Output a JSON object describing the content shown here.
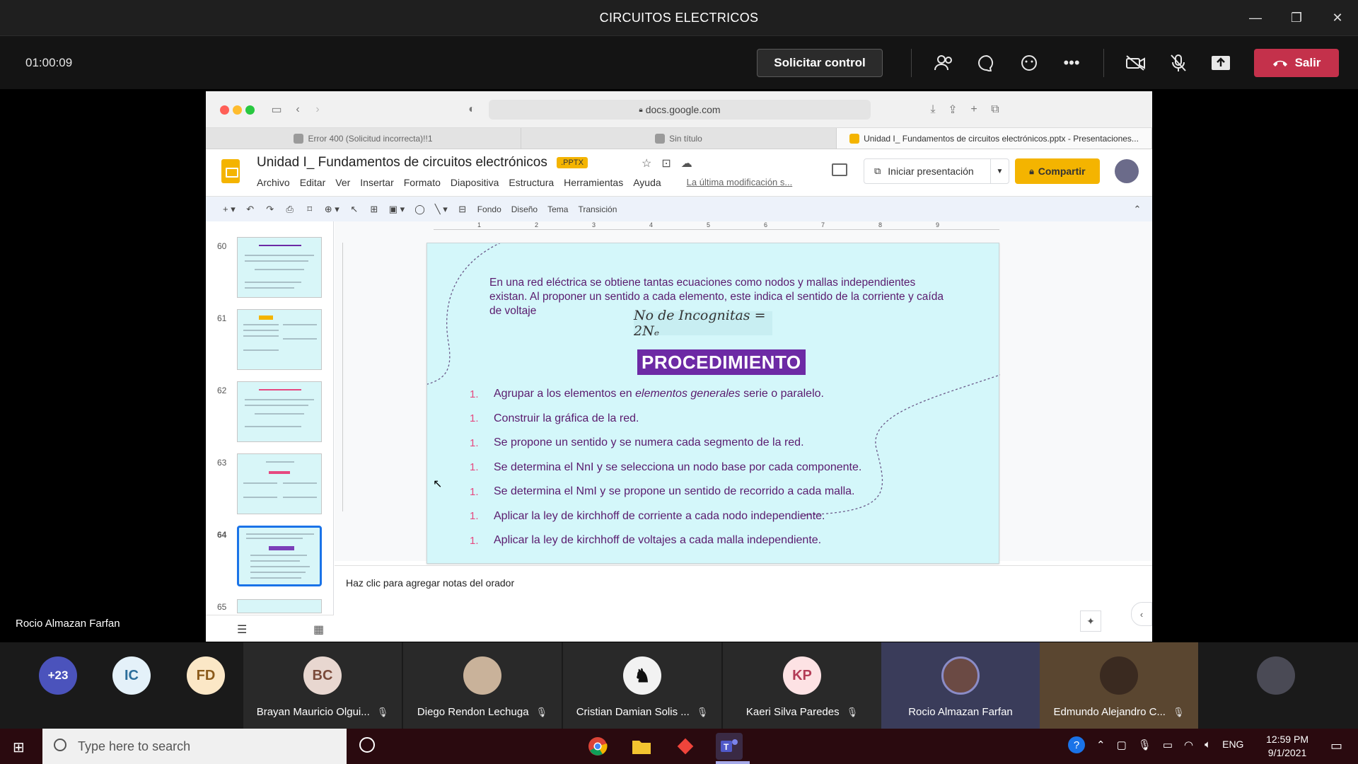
{
  "window": {
    "title": "CIRCUITOS ELECTRICOS",
    "min": "—",
    "max": "❐",
    "close": "✕"
  },
  "meeting": {
    "timer": "01:00:09",
    "request_control": "Solicitar control",
    "leave": "Salir",
    "presenter": "Rocio Almazan Farfan"
  },
  "browser": {
    "url": "docs.google.com",
    "tabs": [
      {
        "label": "Error 400 (Solicitud incorrecta)!!1"
      },
      {
        "label": "Sin título"
      },
      {
        "label": "Unidad I_ Fundamentos de circuitos electrónicos.pptx - Presentaciones..."
      }
    ]
  },
  "docs": {
    "title": "Unidad I_ Fundamentos de circuitos electrónicos",
    "badge": ".PPTX",
    "menu": [
      "Archivo",
      "Editar",
      "Ver",
      "Insertar",
      "Formato",
      "Diapositiva",
      "Estructura",
      "Herramientas",
      "Ayuda"
    ],
    "last_modified": "La última modificación s...",
    "present": "Iniciar presentación",
    "share": "Compartir",
    "toolbar": {
      "background": "Fondo",
      "design": "Diseño",
      "theme": "Tema",
      "transition": "Transición"
    },
    "speaker_notes_placeholder": "Haz clic para agregar notas del orador"
  },
  "thumbnails": [
    {
      "num": "60"
    },
    {
      "num": "61"
    },
    {
      "num": "62"
    },
    {
      "num": "63"
    },
    {
      "num": "64"
    },
    {
      "num": "65"
    }
  ],
  "ruler": [
    "1",
    "2",
    "3",
    "4",
    "5",
    "6",
    "7",
    "8",
    "9"
  ],
  "slide": {
    "intro": "En una red eléctrica se obtiene tantas ecuaciones como nodos y mallas independientes existan. Al proponer un sentido a cada elemento, este indica el sentido de la corriente y caída de voltaje",
    "formula": "No de Incognitas = 2Nₑ",
    "heading": "PROCEDIMIENTO",
    "bullet": "1.",
    "step1_pre": "Agrupar a los elementos en ",
    "step1_em": "elementos generales",
    "step1_post": " serie o paralelo.",
    "steps": [
      "Construir la gráfica de la red.",
      "Se propone un sentido y se numera cada segmento de la red.",
      "Se determina el NnI y se selecciona un nodo base por cada componente.",
      "Se determina el NmI y se propone un sentido de recorrido a cada malla.",
      "Aplicar la ley de kirchhoff de corriente a cada nodo independiente.",
      "Aplicar la ley de kirchhoff de voltajes a cada malla independiente."
    ]
  },
  "participants": [
    {
      "initials": "+23",
      "color": "#4b53bc"
    },
    {
      "initials": "IC",
      "color": "#e4f1f9"
    },
    {
      "initials": "FD",
      "color": "#fbe7c6"
    },
    {
      "initials": "BC",
      "name": "Brayan Mauricio Olgui...",
      "color": "#e8d7d0"
    },
    {
      "name": "Diego Rendon Lechuga"
    },
    {
      "name": "Cristian Damian Solis ..."
    },
    {
      "initials": "KP",
      "name": "Kaeri Silva Paredes",
      "color": "#fde2e4"
    },
    {
      "name": "Rocio Almazan Farfan"
    },
    {
      "name": "Edmundo Alejandro C..."
    }
  ],
  "taskbar": {
    "search_placeholder": "Type here to search",
    "lang": "ENG",
    "time": "12:59 PM",
    "date": "9/1/2021"
  }
}
